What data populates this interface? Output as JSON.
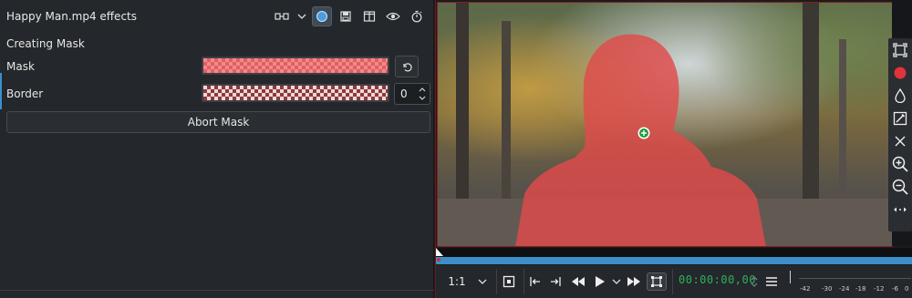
{
  "effects_panel": {
    "title": "Happy Man.mp4 effects",
    "section": "Creating Mask",
    "mask_label": "Mask",
    "border_label": "Border",
    "border_value": "0",
    "abort_label": "Abort Mask"
  },
  "toolbar_icons": [
    "compare-icon",
    "chevron-down-icon",
    "effect-enable-icon",
    "save-preset-icon",
    "split-view-icon",
    "eye-icon",
    "timer-icon"
  ],
  "monitor": {
    "zoom": "1:1",
    "timecode": "00:00:00,00",
    "vu_labels": [
      "-42",
      "-30",
      "-24",
      "-18",
      "-12",
      "-6",
      "0"
    ]
  },
  "colors": {
    "mask_overlay": "#e04a4a",
    "accent": "#3d8fca",
    "timecode": "#2fb05a",
    "record": "#e0343a"
  }
}
